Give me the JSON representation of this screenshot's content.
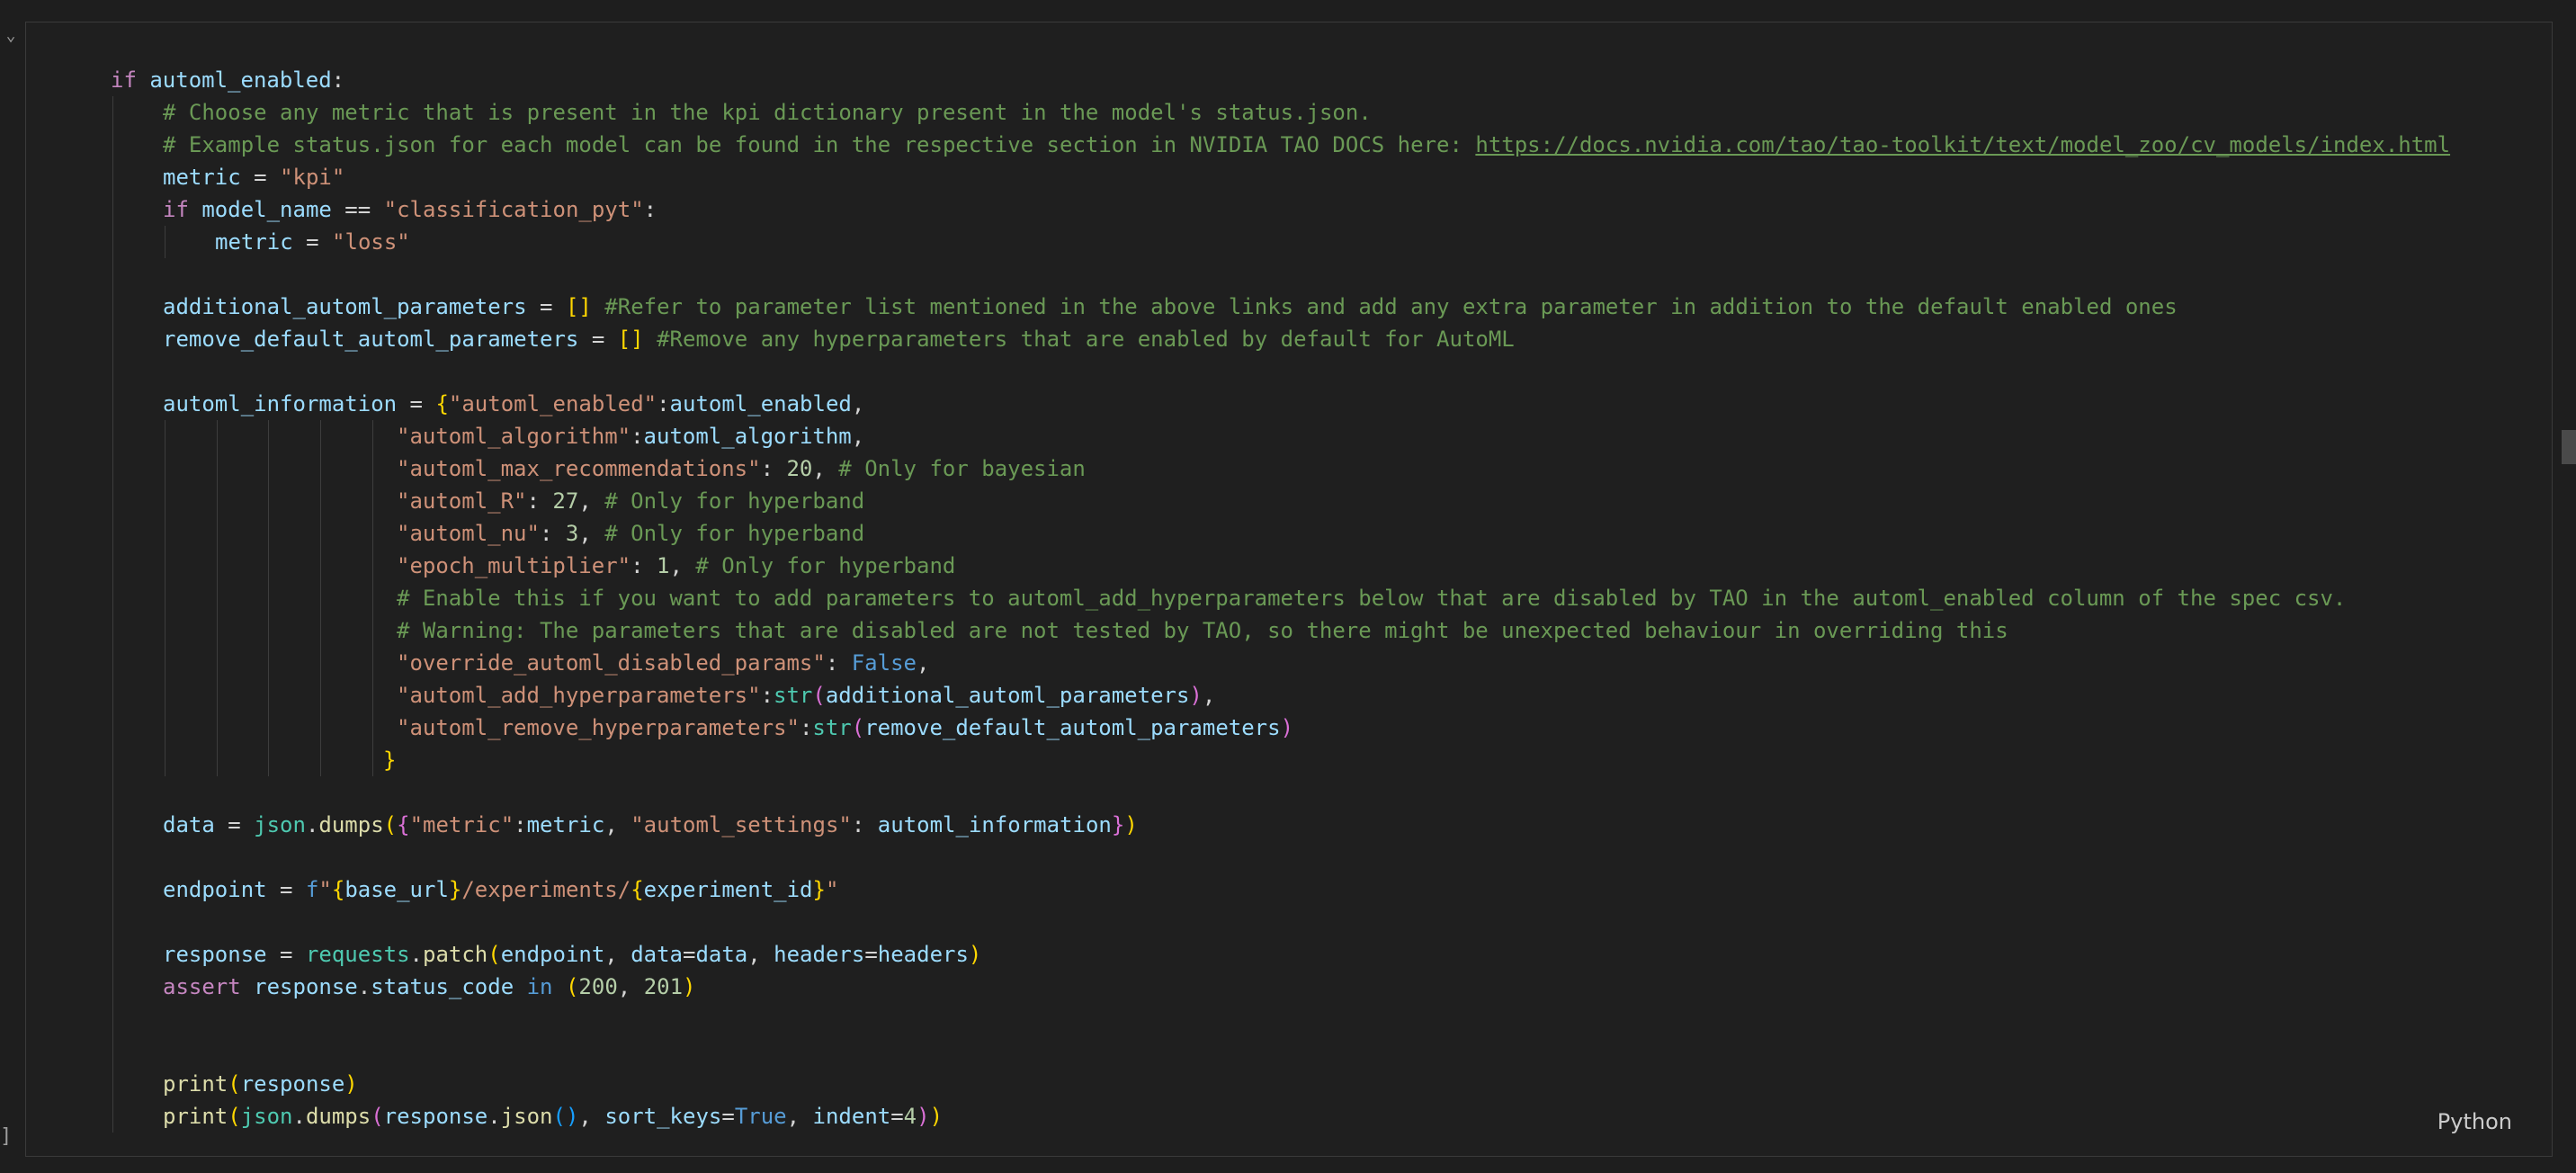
{
  "cell": {
    "language": "Python",
    "lines": [
      {
        "d": 0,
        "t": [
          [
            "kw",
            "if "
          ],
          [
            "vr",
            "automl_enabled"
          ],
          [
            "op",
            ":"
          ]
        ]
      },
      {
        "d": 1,
        "t": [
          [
            "cm",
            "# Choose any metric that is present in the kpi dictionary present in the model's status.json."
          ]
        ]
      },
      {
        "d": 1,
        "t": [
          [
            "cm",
            "# Example status.json for each model can be found in the respective section in NVIDIA TAO DOCS here: "
          ],
          [
            "lnk",
            "https://docs.nvidia.com/tao/tao-toolkit/text/model_zoo/cv_models/index.html"
          ]
        ]
      },
      {
        "d": 1,
        "t": [
          [
            "vr",
            "metric"
          ],
          [
            "op",
            " = "
          ],
          [
            "st",
            "\"kpi\""
          ]
        ]
      },
      {
        "d": 1,
        "t": [
          [
            "kw",
            "if "
          ],
          [
            "vr",
            "model_name"
          ],
          [
            "op",
            " == "
          ],
          [
            "st",
            "\"classification_pyt\""
          ],
          [
            "op",
            ":"
          ]
        ]
      },
      {
        "d": 2,
        "t": [
          [
            "vr",
            "metric"
          ],
          [
            "op",
            " = "
          ],
          [
            "st",
            "\"loss\""
          ]
        ]
      },
      {
        "d": 1,
        "t": []
      },
      {
        "d": 1,
        "t": [
          [
            "vr",
            "additional_automl_parameters"
          ],
          [
            "op",
            " = "
          ],
          [
            "b1",
            "[]"
          ],
          [
            "op",
            " "
          ],
          [
            "cm",
            "#Refer to parameter list mentioned in the above links and add any extra parameter in addition to the default enabled ones"
          ]
        ]
      },
      {
        "d": 1,
        "t": [
          [
            "vr",
            "remove_default_automl_parameters"
          ],
          [
            "op",
            " = "
          ],
          [
            "b1",
            "[]"
          ],
          [
            "op",
            " "
          ],
          [
            "cm",
            "#Remove any hyperparameters that are enabled by default for AutoML"
          ]
        ]
      },
      {
        "d": 1,
        "t": []
      },
      {
        "d": 1,
        "t": [
          [
            "vr",
            "automl_information"
          ],
          [
            "op",
            " = "
          ],
          [
            "b1",
            "{"
          ],
          [
            "st",
            "\"automl_enabled\""
          ],
          [
            "op",
            ":"
          ],
          [
            "vr",
            "automl_enabled"
          ],
          [
            "op",
            ","
          ]
        ]
      },
      {
        "d": 6,
        "c": 22,
        "t": [
          [
            "st",
            "\"automl_algorithm\""
          ],
          [
            "op",
            ":"
          ],
          [
            "vr",
            "automl_algorithm"
          ],
          [
            "op",
            ","
          ]
        ]
      },
      {
        "d": 6,
        "c": 22,
        "t": [
          [
            "st",
            "\"automl_max_recommendations\""
          ],
          [
            "op",
            ": "
          ],
          [
            "nm",
            "20"
          ],
          [
            "op",
            ", "
          ],
          [
            "cm",
            "# Only for bayesian"
          ]
        ]
      },
      {
        "d": 6,
        "c": 22,
        "t": [
          [
            "st",
            "\"automl_R\""
          ],
          [
            "op",
            ": "
          ],
          [
            "nm",
            "27"
          ],
          [
            "op",
            ", "
          ],
          [
            "cm",
            "# Only for hyperband"
          ]
        ]
      },
      {
        "d": 6,
        "c": 22,
        "t": [
          [
            "st",
            "\"automl_nu\""
          ],
          [
            "op",
            ": "
          ],
          [
            "nm",
            "3"
          ],
          [
            "op",
            ", "
          ],
          [
            "cm",
            "# Only for hyperband"
          ]
        ]
      },
      {
        "d": 6,
        "c": 22,
        "t": [
          [
            "st",
            "\"epoch_multiplier\""
          ],
          [
            "op",
            ": "
          ],
          [
            "nm",
            "1"
          ],
          [
            "op",
            ", "
          ],
          [
            "cm",
            "# Only for hyperband"
          ]
        ]
      },
      {
        "d": 6,
        "c": 22,
        "t": [
          [
            "cm",
            "# Enable this if you want to add parameters to automl_add_hyperparameters below that are disabled by TAO in the automl_enabled column of the spec csv."
          ]
        ]
      },
      {
        "d": 6,
        "c": 22,
        "t": [
          [
            "cm",
            "# Warning: The parameters that are disabled are not tested by TAO, so there might be unexpected behaviour in overriding this"
          ]
        ]
      },
      {
        "d": 6,
        "c": 22,
        "t": [
          [
            "st",
            "\"override_automl_disabled_params\""
          ],
          [
            "op",
            ": "
          ],
          [
            "bl",
            "False"
          ],
          [
            "op",
            ","
          ]
        ]
      },
      {
        "d": 6,
        "c": 22,
        "t": [
          [
            "st",
            "\"automl_add_hyperparameters\""
          ],
          [
            "op",
            ":"
          ],
          [
            "cl",
            "str"
          ],
          [
            "b2",
            "("
          ],
          [
            "vr",
            "additional_automl_parameters"
          ],
          [
            "b2",
            ")"
          ],
          [
            "op",
            ","
          ]
        ]
      },
      {
        "d": 6,
        "c": 22,
        "t": [
          [
            "st",
            "\"automl_remove_hyperparameters\""
          ],
          [
            "op",
            ":"
          ],
          [
            "cl",
            "str"
          ],
          [
            "b2",
            "("
          ],
          [
            "vr",
            "remove_default_automl_parameters"
          ],
          [
            "b2",
            ")"
          ]
        ]
      },
      {
        "d": 6,
        "c": 21,
        "t": [
          [
            "b1",
            "}"
          ]
        ]
      },
      {
        "d": 1,
        "t": []
      },
      {
        "d": 1,
        "t": [
          [
            "vr",
            "data"
          ],
          [
            "op",
            " = "
          ],
          [
            "cl",
            "json"
          ],
          [
            "op",
            "."
          ],
          [
            "fn",
            "dumps"
          ],
          [
            "b1",
            "("
          ],
          [
            "b2",
            "{"
          ],
          [
            "st",
            "\"metric\""
          ],
          [
            "op",
            ":"
          ],
          [
            "vr",
            "metric"
          ],
          [
            "op",
            ", "
          ],
          [
            "st",
            "\"automl_settings\""
          ],
          [
            "op",
            ": "
          ],
          [
            "vr",
            "automl_information"
          ],
          [
            "b2",
            "}"
          ],
          [
            "b1",
            ")"
          ]
        ]
      },
      {
        "d": 1,
        "t": []
      },
      {
        "d": 1,
        "t": [
          [
            "vr",
            "endpoint"
          ],
          [
            "op",
            " = "
          ],
          [
            "bl",
            "f"
          ],
          [
            "st",
            "\""
          ],
          [
            "b1",
            "{"
          ],
          [
            "vr",
            "base_url"
          ],
          [
            "b1",
            "}"
          ],
          [
            "st",
            "/experiments/"
          ],
          [
            "b1",
            "{"
          ],
          [
            "vr",
            "experiment_id"
          ],
          [
            "b1",
            "}"
          ],
          [
            "st",
            "\""
          ]
        ]
      },
      {
        "d": 1,
        "t": []
      },
      {
        "d": 1,
        "t": [
          [
            "vr",
            "response"
          ],
          [
            "op",
            " = "
          ],
          [
            "cl",
            "requests"
          ],
          [
            "op",
            "."
          ],
          [
            "fn",
            "patch"
          ],
          [
            "b1",
            "("
          ],
          [
            "vr",
            "endpoint"
          ],
          [
            "op",
            ", "
          ],
          [
            "vr",
            "data"
          ],
          [
            "op",
            "="
          ],
          [
            "vr",
            "data"
          ],
          [
            "op",
            ", "
          ],
          [
            "vr",
            "headers"
          ],
          [
            "op",
            "="
          ],
          [
            "vr",
            "headers"
          ],
          [
            "b1",
            ")"
          ]
        ]
      },
      {
        "d": 1,
        "t": [
          [
            "kw",
            "assert "
          ],
          [
            "vr",
            "response"
          ],
          [
            "op",
            "."
          ],
          [
            "vr",
            "status_code"
          ],
          [
            "op",
            " "
          ],
          [
            "bl",
            "in"
          ],
          [
            "op",
            " "
          ],
          [
            "b1",
            "("
          ],
          [
            "nm",
            "200"
          ],
          [
            "op",
            ", "
          ],
          [
            "nm",
            "201"
          ],
          [
            "b1",
            ")"
          ]
        ]
      },
      {
        "d": 1,
        "t": []
      },
      {
        "d": 1,
        "t": []
      },
      {
        "d": 1,
        "t": [
          [
            "fn",
            "print"
          ],
          [
            "b1",
            "("
          ],
          [
            "vr",
            "response"
          ],
          [
            "b1",
            ")"
          ]
        ]
      },
      {
        "d": 1,
        "t": [
          [
            "fn",
            "print"
          ],
          [
            "b1",
            "("
          ],
          [
            "cl",
            "json"
          ],
          [
            "op",
            "."
          ],
          [
            "fn",
            "dumps"
          ],
          [
            "b2",
            "("
          ],
          [
            "vr",
            "response"
          ],
          [
            "op",
            "."
          ],
          [
            "fn",
            "json"
          ],
          [
            "b3",
            "()"
          ],
          [
            "op",
            ", "
          ],
          [
            "vr",
            "sort_keys"
          ],
          [
            "op",
            "="
          ],
          [
            "bl",
            "True"
          ],
          [
            "op",
            ", "
          ],
          [
            "vr",
            "indent"
          ],
          [
            "op",
            "="
          ],
          [
            "nm",
            "4"
          ],
          [
            "b2",
            ")"
          ],
          [
            "b1",
            ")"
          ]
        ]
      }
    ]
  }
}
